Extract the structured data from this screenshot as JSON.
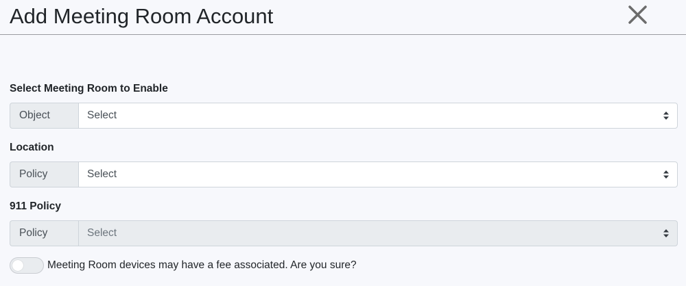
{
  "modal": {
    "title": "Add Meeting Room Account",
    "close_icon": "close-icon"
  },
  "fields": [
    {
      "label": "Select Meeting Room to Enable",
      "addon": "Object",
      "value": "Select",
      "disabled": false
    },
    {
      "label": "Location",
      "addon": "Policy",
      "value": "Select",
      "disabled": false
    },
    {
      "label": "911 Policy",
      "addon": "Policy",
      "value": "Select",
      "disabled": true
    }
  ],
  "confirm": {
    "toggle_on": false,
    "text": "Meeting Room devices may have a fee associated. Are you sure?"
  },
  "colors": {
    "background": "#f7f8fc",
    "addon_background": "#e9ecef",
    "border": "#ced4da",
    "close_icon": "#6c6c6c"
  }
}
